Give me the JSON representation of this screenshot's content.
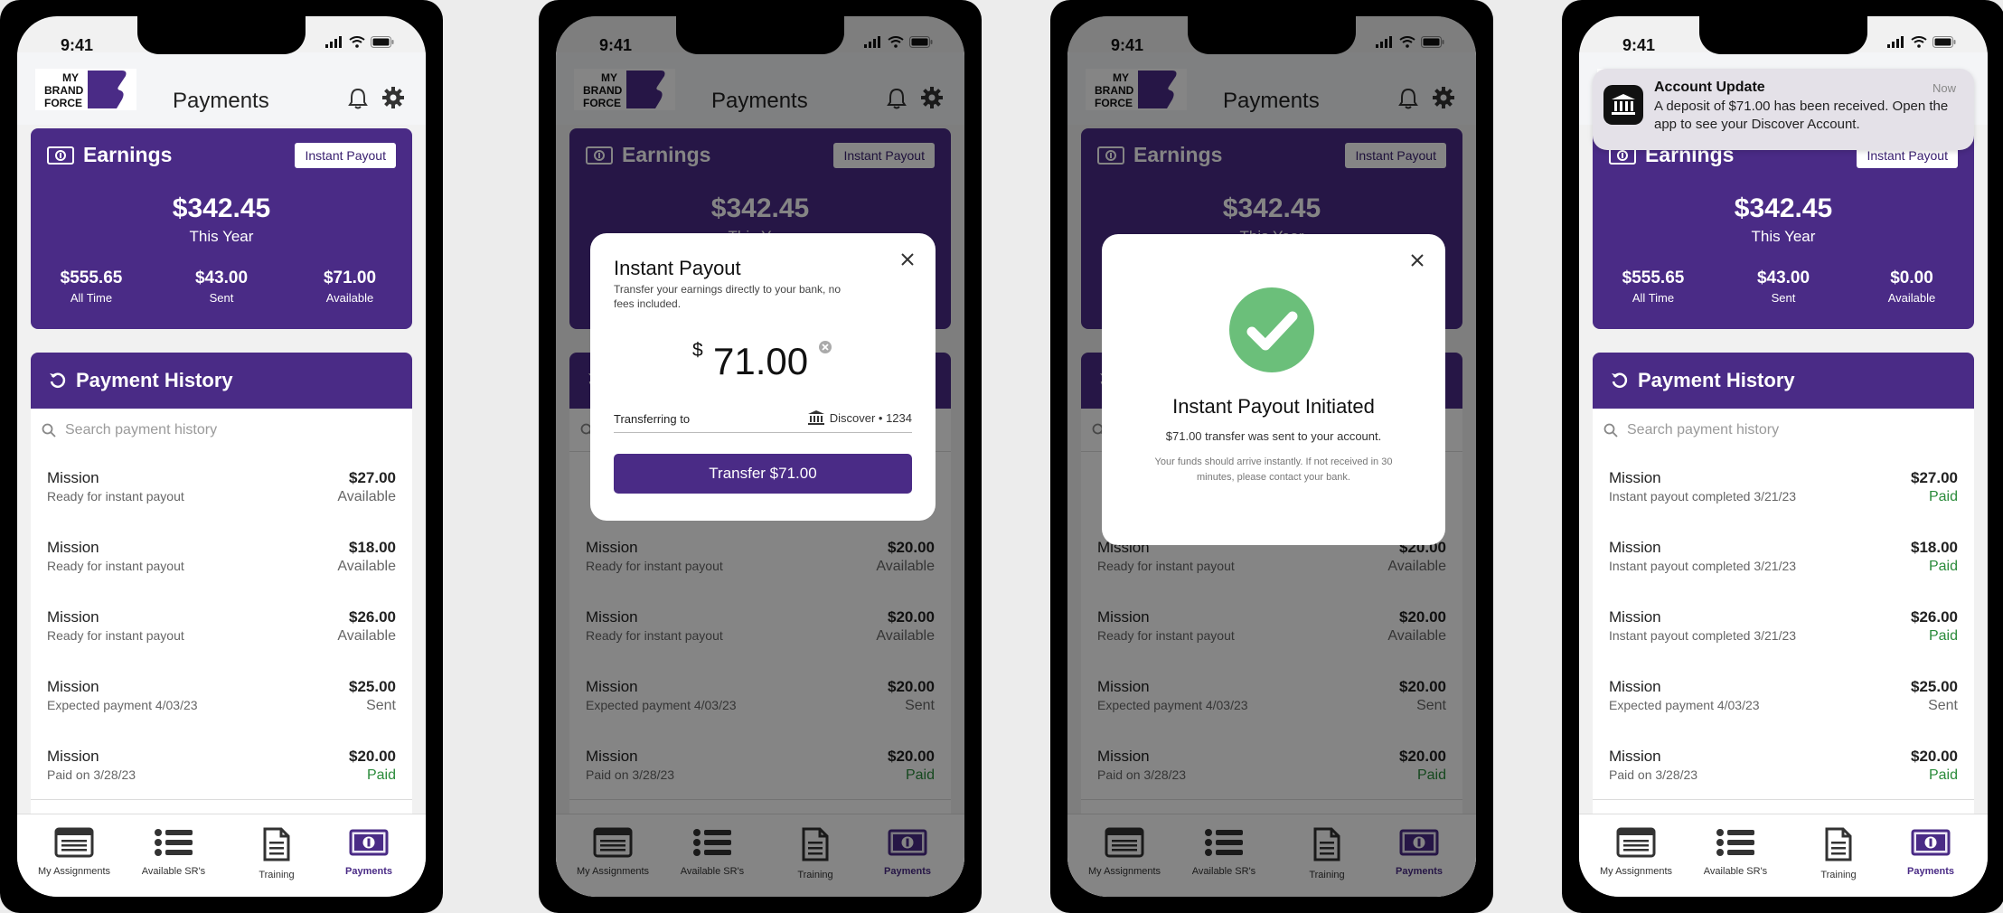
{
  "colors": {
    "brand_purple": "#4a2b86",
    "paid_green": "#2a8b3a",
    "success_green": "#6bbf7a"
  },
  "status": {
    "time": "9:41"
  },
  "header": {
    "title": "Payments",
    "logo_lines": [
      "MY",
      "BRAND",
      "FORCE"
    ]
  },
  "earnings": {
    "title": "Earnings",
    "instant_payout_label": "Instant Payout",
    "this_year_label": "This Year",
    "all_time_label": "All Time",
    "sent_label": "Sent",
    "available_label": "Available",
    "this_year_value": "$342.45",
    "all_time_value": "$555.65",
    "sent_value": "$43.00",
    "available_before": "$71.00",
    "available_after": "$0.00"
  },
  "history": {
    "title": "Payment History",
    "search_placeholder": "Search payment history",
    "screen1_rows": [
      {
        "title": "Mission",
        "detail": "Ready for instant payout",
        "amount": "$27.00",
        "status": "Available"
      },
      {
        "title": "Mission",
        "detail": "Ready for instant payout",
        "amount": "$18.00",
        "status": "Available"
      },
      {
        "title": "Mission",
        "detail": "Ready for instant payout",
        "amount": "$26.00",
        "status": "Available"
      },
      {
        "title": "Mission",
        "detail": "Expected payment 4/03/23",
        "amount": "$25.00",
        "status": "Sent"
      },
      {
        "title": "Mission",
        "detail": "Paid on 3/28/23",
        "amount": "$20.00",
        "status": "Paid"
      }
    ],
    "dim_rows": [
      {
        "title": "Mission",
        "detail": "Ready for instant payout",
        "amount": "$20.00",
        "status": "Available"
      },
      {
        "title": "Mission",
        "detail": "Ready for instant payout",
        "amount": "$20.00",
        "status": "Available"
      },
      {
        "title": "Mission",
        "detail": "Expected payment 4/03/23",
        "amount": "$20.00",
        "status": "Sent"
      },
      {
        "title": "Mission",
        "detail": "Paid on 3/28/23",
        "amount": "$20.00",
        "status": "Paid"
      }
    ],
    "screen4_rows": [
      {
        "title": "Mission",
        "detail": "Instant payout completed 3/21/23",
        "amount": "$27.00",
        "status": "Paid"
      },
      {
        "title": "Mission",
        "detail": "Instant payout completed 3/21/23",
        "amount": "$18.00",
        "status": "Paid"
      },
      {
        "title": "Mission",
        "detail": "Instant payout completed 3/21/23",
        "amount": "$26.00",
        "status": "Paid"
      },
      {
        "title": "Mission",
        "detail": "Expected payment 4/03/23",
        "amount": "$25.00",
        "status": "Sent"
      },
      {
        "title": "Mission",
        "detail": "Paid on 3/28/23",
        "amount": "$20.00",
        "status": "Paid"
      }
    ]
  },
  "tabs": [
    {
      "label": "My Assignments",
      "icon": "assignments-icon"
    },
    {
      "label": "Available SR's",
      "icon": "list-icon"
    },
    {
      "label": "Training",
      "icon": "document-icon"
    },
    {
      "label": "Payments",
      "icon": "money-icon"
    }
  ],
  "payout_modal": {
    "title": "Instant Payout",
    "description": "Transfer your earnings directly to your bank, no fees included.",
    "currency": "$",
    "amount": "71.00",
    "transferring_label": "Transferring to",
    "bank": "Discover • 1234",
    "button_label": "Transfer $71.00"
  },
  "success_modal": {
    "title": "Instant Payout Initiated",
    "line1": "$71.00 transfer was sent to your account.",
    "line2": "Your funds should arrive instantly. If not received in 30 minutes, please contact your bank."
  },
  "notification": {
    "title": "Account Update",
    "body": "A deposit of $71.00 has been received. Open the app to see your Discover Account.",
    "time": "Now"
  }
}
